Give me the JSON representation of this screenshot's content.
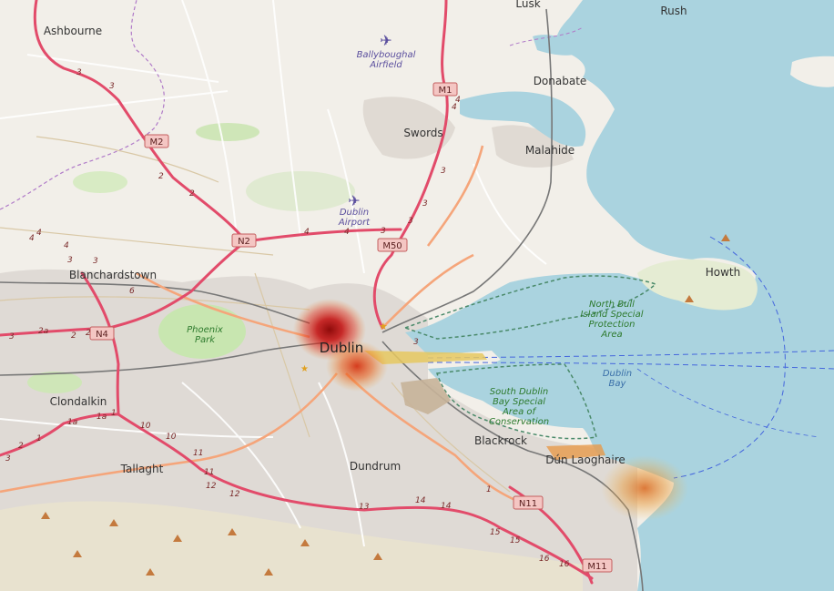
{
  "map": {
    "towns": {
      "ashbourne": "Ashbourne",
      "lusk": "Lusk",
      "rush": "Rush",
      "donabate": "Donabate",
      "swords": "Swords",
      "malahide": "Malahide",
      "howth": "Howth",
      "blanchardstown": "Blanchardstown",
      "clondalkin": "Clondalkin",
      "tallaght": "Tallaght",
      "dundrum": "Dundrum",
      "blackrock": "Blackrock",
      "dun_laoghaire": "Dún Laoghaire",
      "dublin": "Dublin"
    },
    "areas": {
      "ballyboughal_1": "Ballyboughal",
      "ballyboughal_2": "Airfield",
      "airport_1": "Dublin",
      "airport_2": "Airport",
      "phoenix_1": "Phoenix",
      "phoenix_2": "Park",
      "nbull_1": "North Bull",
      "nbull_2": "Island Special",
      "nbull_3": "Protection",
      "nbull_4": "Area",
      "sdb_1": "South Dublin",
      "sdb_2": "Bay Special",
      "sdb_3": "Area of",
      "sdb_4": "Conservation",
      "bay_1": "Dublin",
      "bay_2": "Bay"
    },
    "shields": {
      "m1": "M1",
      "m2": "M2",
      "n2": "N2",
      "m50": "M50",
      "n4": "N4",
      "n11": "N11",
      "m11": "M11"
    },
    "junctions": [
      "3",
      "3",
      "2",
      "2",
      "4",
      "4",
      "3",
      "3",
      "3",
      "3",
      "4",
      "4",
      "3",
      "3",
      "2a",
      "2",
      "6",
      "1a",
      "1a",
      "1",
      "10",
      "10",
      "11",
      "11",
      "12",
      "12",
      "13",
      "14",
      "14",
      "15",
      "15",
      "16",
      "16",
      "1",
      "2",
      "3",
      "1",
      "3",
      "4",
      "3",
      "4",
      "4",
      "2"
    ]
  },
  "heatmap": {
    "spots": [
      {
        "name": "dublin-centre-hotspot",
        "intensity": 1.0
      },
      {
        "name": "dublin-south-hotspot",
        "intensity": 0.7
      },
      {
        "name": "dun-laoghaire-hotspot",
        "intensity": 0.45
      }
    ],
    "colors": {
      "hot": "#b50000",
      "mid": "#e23a10",
      "warm": "#f07a1a"
    }
  },
  "colors": {
    "land": "#f2efe9",
    "sea": "#aad3df",
    "park": "#c8e6b0",
    "urban": "#dcd6d1",
    "motorway": "#e24b6a",
    "primary": "#f5a57a"
  }
}
